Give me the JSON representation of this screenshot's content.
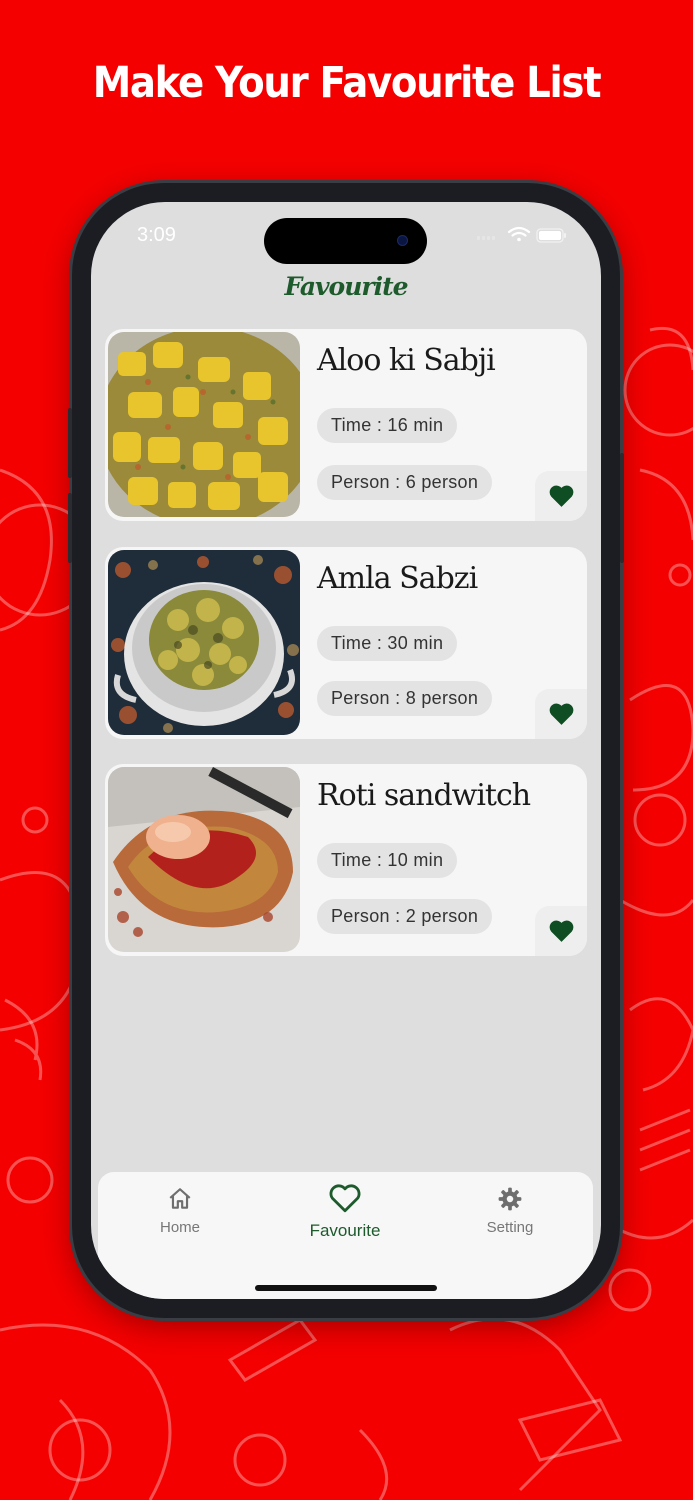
{
  "headline": "Make Your Favourite List",
  "status": {
    "time": "3:09"
  },
  "app_title": "Favourite",
  "recipes": [
    {
      "name": "Aloo ki Sabji",
      "time": "Time : 16 min",
      "person": "Person : 6 person",
      "favourited": true
    },
    {
      "name": "Amla Sabzi",
      "time": "Time : 30 min",
      "person": "Person : 8 person",
      "favourited": true
    },
    {
      "name": "Roti sandwitch",
      "time": "Time : 10 min",
      "person": "Person : 2 person",
      "favourited": true
    }
  ],
  "nav": {
    "items": [
      {
        "label": "Home",
        "icon": "home-icon"
      },
      {
        "label": "Favourite",
        "icon": "heart-outline-icon",
        "active": true
      },
      {
        "label": "Setting",
        "icon": "gear-icon"
      }
    ]
  },
  "colors": {
    "background": "#f40000",
    "accent": "#1d5a2c",
    "heart": "#0f4d22",
    "screen": "#dedede"
  }
}
